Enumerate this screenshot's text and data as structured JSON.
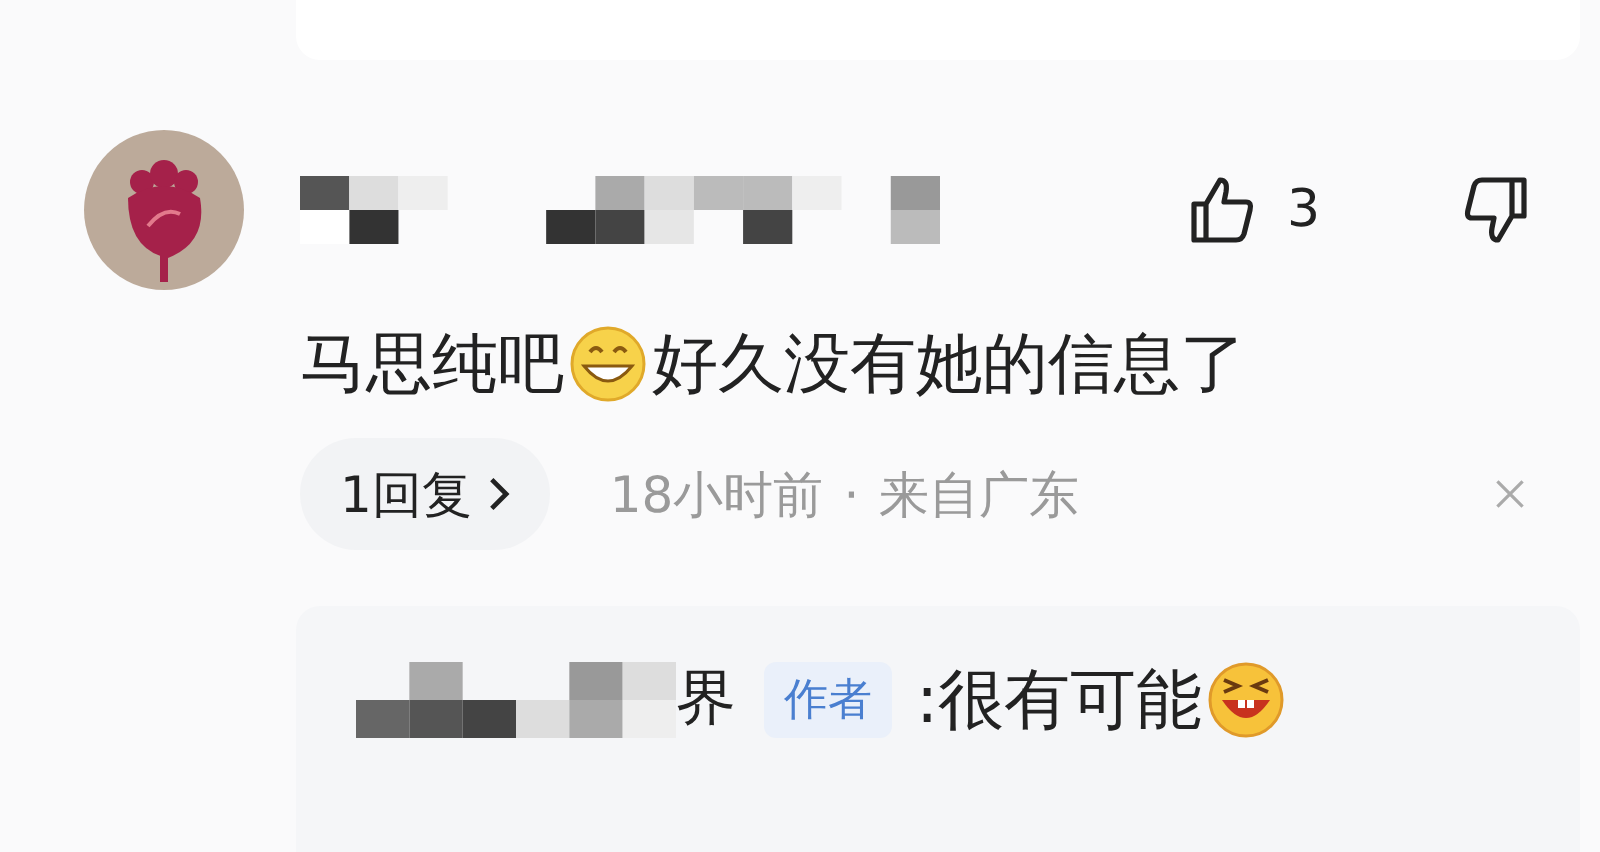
{
  "comment": {
    "likes": "3",
    "content": [
      {
        "kind": "text",
        "text": "马思纯吧"
      },
      {
        "kind": "grin"
      },
      {
        "kind": "text",
        "text": "好久没有她的信息了"
      }
    ],
    "replies_button": {
      "count": "1",
      "label": "回复"
    },
    "time": "18小时前",
    "separator": "·",
    "location": "来自广东"
  },
  "reply": {
    "name_tail": "界",
    "badge": "作者",
    "content": [
      {
        "kind": "text",
        "text": ":很有可能"
      },
      {
        "kind": "laugh"
      }
    ]
  }
}
